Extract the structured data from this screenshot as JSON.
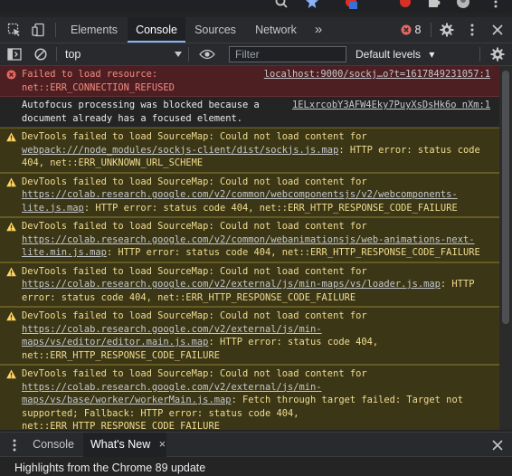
{
  "browser_strip": {
    "icons": [
      "search-icon",
      "star-icon",
      "extension-icon",
      "puzzle-icon",
      "profile-avatar-icon",
      "kebab-menu-icon"
    ]
  },
  "devtools": {
    "tabs": [
      {
        "label": "Elements"
      },
      {
        "label": "Console"
      },
      {
        "label": "Sources"
      },
      {
        "label": "Network"
      }
    ],
    "more_tabs_glyph": "»",
    "error_count": "8",
    "active_tab": "Console"
  },
  "console_toolbar": {
    "context": "top",
    "filter_placeholder": "Filter",
    "levels_label": "Default levels",
    "levels_glyph": "▾"
  },
  "messages": [
    {
      "level": "error",
      "text": "Failed to load resource: net::ERR_CONNECTION_REFUSED",
      "source": "localhost:9000/sockj…o?t=1617849231057:1"
    },
    {
      "level": "info",
      "text": "Autofocus processing was blocked because a document already has a focused element.",
      "source": "1ELxrcobY3AFW4Eky7PuyXsDsHk6o nXm:1"
    },
    {
      "level": "warning",
      "prefix": "DevTools failed to load SourceMap: Could not load content for ",
      "link": "webpack:///node_modules/sockjs-client/dist/sockjs.js.map",
      "suffix": ": HTTP error: status code 404, net::ERR_UNKNOWN_URL_SCHEME"
    },
    {
      "level": "warning",
      "prefix": "DevTools failed to load SourceMap: Could not load content for ",
      "link": "https://colab.research.google.com/v2/common/webcomponentsjs/v2/webcomponents-lite.js.map",
      "suffix": ": HTTP error: status code 404, net::ERR_HTTP_RESPONSE_CODE_FAILURE"
    },
    {
      "level": "warning",
      "prefix": "DevTools failed to load SourceMap: Could not load content for ",
      "link": "https://colab.research.google.com/v2/common/webanimationsjs/web-animations-next-lite.min.js.map",
      "suffix": ": HTTP error: status code 404, net::ERR_HTTP_RESPONSE_CODE_FAILURE"
    },
    {
      "level": "warning",
      "prefix": "DevTools failed to load SourceMap: Could not load content for ",
      "link": "https://colab.research.google.com/v2/external/js/min-maps/vs/loader.js.map",
      "suffix": ": HTTP error: status code 404, net::ERR_HTTP_RESPONSE_CODE_FAILURE"
    },
    {
      "level": "warning",
      "prefix": "DevTools failed to load SourceMap: Could not load content for ",
      "link": "https://colab.research.google.com/v2/external/js/min-maps/vs/editor/editor.main.js.map",
      "suffix": ": HTTP error: status code 404, net::ERR_HTTP_RESPONSE_CODE_FAILURE"
    },
    {
      "level": "warning",
      "prefix": "DevTools failed to load SourceMap: Could not load content for ",
      "link": "https://colab.research.google.com/v2/external/js/min-maps/vs/base/worker/workerMain.js.map",
      "suffix": ": Fetch through target failed: Target not supported; Fallback: HTTP error: status code 404, net::ERR_HTTP_RESPONSE_CODE_FAILURE"
    }
  ],
  "prompt": {
    "chevron": "›"
  },
  "drawer": {
    "tabs": [
      {
        "label": "Console"
      },
      {
        "label": "What's New"
      }
    ],
    "close_glyph": "×",
    "body_text": "Highlights from the Chrome 89 update"
  },
  "colors": {
    "accent": "#8ab4f8",
    "error_bg": "#4e1f22",
    "error_text": "#f28b82",
    "warning_bg": "#3b3616",
    "warning_text": "#f0dc91",
    "warning_icon": "#fdd663"
  }
}
